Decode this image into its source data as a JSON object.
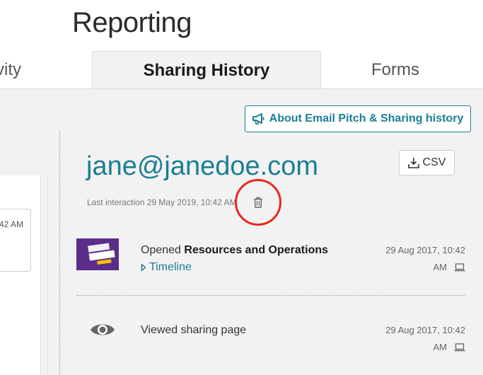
{
  "header": {
    "title": "Reporting"
  },
  "tabs": [
    {
      "label": "ctivity"
    },
    {
      "label": "Sharing History"
    },
    {
      "label": "Forms"
    }
  ],
  "about_button": {
    "label": "About Email Pitch & Sharing history",
    "icon": "megaphone-icon"
  },
  "left_card": {
    "text": "42 AM"
  },
  "contact": {
    "email": "jane@janedoe.com",
    "last_interaction": "Last interaction 29 May 2019, 10:42 AM",
    "csv_label": "CSV"
  },
  "activities": [
    {
      "prefix": "Opened ",
      "item": "Resources and Operations",
      "link": "Timeline",
      "date_line1": "29 Aug 2017, 10:42",
      "date_line2": "AM",
      "device_icon": "laptop-icon"
    },
    {
      "prefix": "Viewed sharing page",
      "item": "",
      "date_line1": "29 Aug 2017, 10:42",
      "date_line2": "AM",
      "device_icon": "laptop-icon"
    }
  ],
  "colors": {
    "accent": "#1a7e95",
    "highlight": "#e8281e",
    "thumb": "#5b2d8b"
  }
}
